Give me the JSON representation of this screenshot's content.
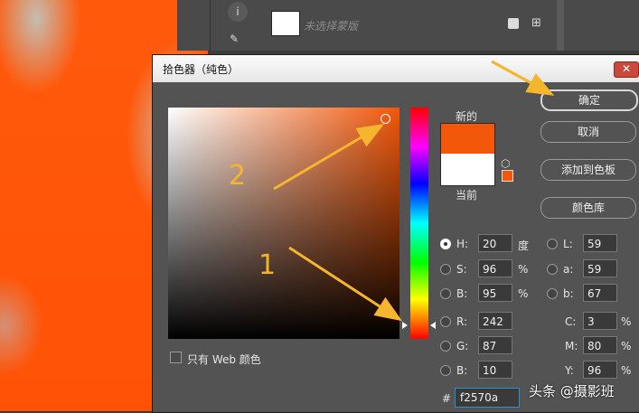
{
  "layers_panel": {
    "layer_name": "未选择蒙版",
    "info_icon": "i"
  },
  "dialog": {
    "title": "拾色器（纯色）",
    "close_label": "✕",
    "new_label": "新的",
    "current_label": "当前",
    "new_color": "#f2570a",
    "current_color": "#ffffff",
    "buttons": {
      "ok": "确定",
      "cancel": "取消",
      "add_swatch": "添加到色板",
      "libraries": "颜色库"
    },
    "only_web": "只有 Web 颜色",
    "fields": {
      "H": {
        "label": "H:",
        "value": "20",
        "unit": "度"
      },
      "S": {
        "label": "S:",
        "value": "96",
        "unit": "%"
      },
      "B": {
        "label": "B:",
        "value": "95",
        "unit": "%"
      },
      "R": {
        "label": "R:",
        "value": "242"
      },
      "G": {
        "label": "G:",
        "value": "87"
      },
      "Bb": {
        "label": "B:",
        "value": "10"
      },
      "L": {
        "label": "L:",
        "value": "59"
      },
      "a": {
        "label": "a:",
        "value": "59"
      },
      "b": {
        "label": "b:",
        "value": "67"
      },
      "C": {
        "label": "C:",
        "value": "3",
        "unit": "%"
      },
      "M": {
        "label": "M:",
        "value": "80",
        "unit": "%"
      },
      "Y": {
        "label": "Y:",
        "value": "96",
        "unit": "%"
      }
    },
    "hex_hash": "#",
    "hex": "f2570a"
  },
  "annotations": {
    "one": "1",
    "two": "2",
    "arrow_color": "#f5b52c"
  },
  "watermark": "头条 @摄影班"
}
